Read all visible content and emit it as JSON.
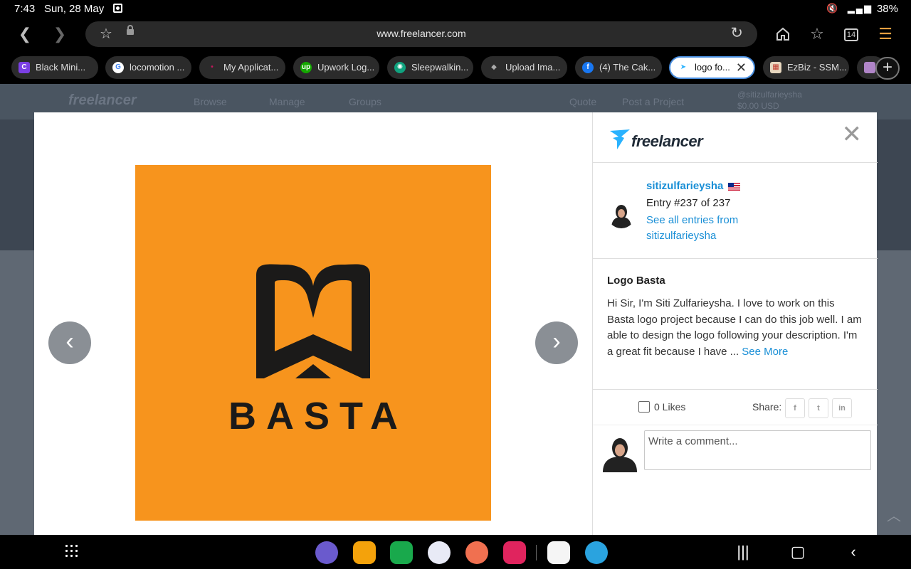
{
  "status_bar": {
    "time": "7:43",
    "date": "Sun, 28 May",
    "battery": "38%"
  },
  "browser": {
    "url": "www.freelancer.com",
    "tab_count": "14",
    "tabs": [
      {
        "label": "Black Mini...",
        "favicon": "canva-icon",
        "color": "#7b3fe4"
      },
      {
        "label": "locomotion ...",
        "favicon": "google-icon",
        "color": "#ffffff"
      },
      {
        "label": "My Applicat...",
        "favicon": "app-icon",
        "color": "#c2185b"
      },
      {
        "label": "Upwork Log...",
        "favicon": "upwork-icon",
        "color": "#14a800"
      },
      {
        "label": "Sleepwalkin...",
        "favicon": "openai-icon",
        "color": "#10a37f"
      },
      {
        "label": "Upload Ima...",
        "favicon": "layers-icon",
        "color": "#555555"
      },
      {
        "label": "(4) The Cak...",
        "favicon": "facebook-icon",
        "color": "#1877f2"
      },
      {
        "label": "logo fo...",
        "favicon": "freelancer-icon",
        "color": "#29b2fe",
        "active": true
      },
      {
        "label": "EzBiz - SSM...",
        "favicon": "ezbiz-icon",
        "color": "#c0392b"
      }
    ]
  },
  "page_header_ghost": {
    "logo": "freelancer",
    "browse": "Browse",
    "manage": "Manage",
    "groups": "Groups",
    "quote": "Quote",
    "post_project": "Post a Project",
    "user": "@sitizulfarieysha",
    "balance": "$0.00 USD"
  },
  "entry": {
    "logo_word": "BASTA",
    "image_bg": "#f7941d"
  },
  "sidebar": {
    "brand": "freelancer",
    "username": "sitizulfarieysha",
    "entry_number": "Entry #237 of 237",
    "see_all": "See all entries from sitizulfarieysha",
    "title": "Logo Basta",
    "description": "Hi Sir, I'm Siti Zulfarieysha. I love to work on this Basta logo project because I can do this job well. I am able to design the logo following your description. I'm a great fit because I have ... ",
    "see_more": "See More",
    "likes": "0 Likes",
    "share_label": "Share:",
    "comment_placeholder": "Write a comment..."
  },
  "colors": {
    "link": "#1a8fd6",
    "accent_border": "#4a8fe0"
  }
}
